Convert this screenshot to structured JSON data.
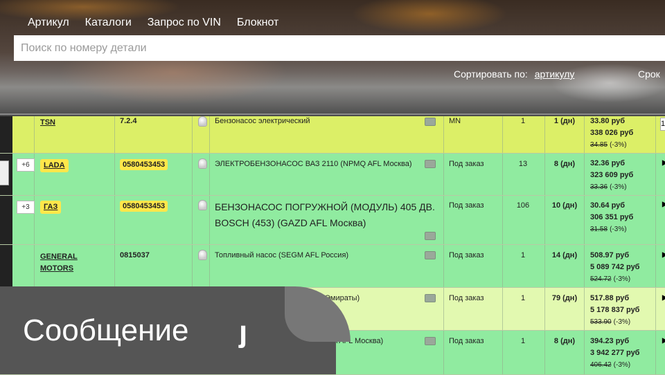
{
  "nav": {
    "items": [
      "Артикул",
      "Каталоги",
      "Запрос по VIN",
      "Блокнот"
    ]
  },
  "search": {
    "placeholder": "Поиск по номеру детали",
    "value": ""
  },
  "sort": {
    "label": "Сортировать по:",
    "value": "артикулу",
    "next_label": "Срок"
  },
  "rows": [
    {
      "brand": "TSN",
      "plus": "",
      "article": "7.2.4",
      "description": "Бензонасос электрический",
      "availability": "MN",
      "qty": "1",
      "days": "1 (дн)",
      "price": "33.80 руб",
      "price_total": "338 026 руб",
      "old_price": "34.85",
      "discount": "(-3%)",
      "right": "1"
    },
    {
      "brand": "LADA",
      "plus": "+6",
      "article": "0580453453",
      "description": "ЭЛЕКТРОБЕНЗОНАСОС ВАЗ 2110 (NPMQ AFL Москва)",
      "availability": "Под заказ",
      "qty": "13",
      "days": "8 (дн)",
      "price": "32.36 руб",
      "price_total": "323 609 руб",
      "old_price": "33.36",
      "discount": "(-3%)",
      "right": ""
    },
    {
      "brand": "ГАЗ",
      "plus": "+3",
      "article": "0580453453",
      "description": "БЕНЗОНАСОС ПОГРУЖНОЙ (МОДУЛЬ) 405 ДВ. BOSCH (453) (GAZD AFL Москва)",
      "availability": "Под заказ",
      "qty": "106",
      "days": "10 (дн)",
      "price": "30.64 руб",
      "price_total": "306 351 руб",
      "old_price": "31.58",
      "discount": "(-3%)",
      "right": ""
    },
    {
      "brand": "GENERAL MOTORS",
      "plus": "",
      "article": "0815037",
      "description": "Топливный насос (SEGM AFL Россия)",
      "availability": "Под заказ",
      "qty": "1",
      "days": "14 (дн)",
      "price": "508.97 руб",
      "price_total": "5 089 742 руб",
      "old_price": "524.72",
      "discount": "(-3%)",
      "right": ""
    },
    {
      "brand": "",
      "plus": "",
      "article": "",
      "description": "MCN Эмираты)",
      "availability": "Под заказ",
      "qty": "1",
      "days": "79 (дн)",
      "price": "517.88 руб",
      "price_total": "5 178 837 руб",
      "old_price": "533.90",
      "discount": "(-3%)",
      "right": ""
    },
    {
      "brand": "",
      "plus": "",
      "article": "",
      "description": "A AFL Москва)",
      "availability": "Под заказ",
      "qty": "1",
      "days": "8 (дн)",
      "price": "394.23 руб",
      "price_total": "3 942 277 руб",
      "old_price": "406.42",
      "discount": "(-3%)",
      "right": ""
    }
  ],
  "overlay": {
    "text": "Сообщение",
    "icon": "cursor-icon"
  }
}
